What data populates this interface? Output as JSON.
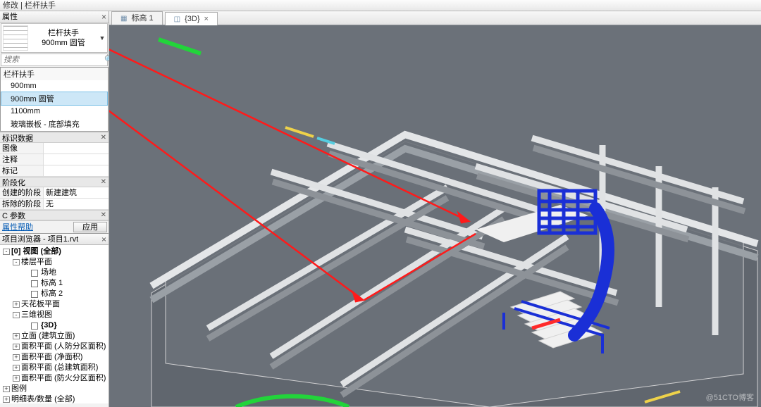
{
  "titlebar": "修改 | 栏杆扶手",
  "properties": {
    "panel_title": "属性",
    "type_name": "栏杆扶手",
    "type_sub": "900mm 圆管",
    "search_placeholder": "搜索",
    "dropdown_category": "栏杆扶手",
    "dropdown_options": [
      "900mm",
      "900mm 圆管",
      "1100mm",
      "玻璃嵌板 - 底部填充"
    ],
    "selected_index": 1,
    "sections": {
      "id_data": "标识数据",
      "image": "图像",
      "note": "注释",
      "mark": "标记",
      "phase": "阶段化",
      "created_phase_k": "创建的阶段",
      "created_phase_v": "新建建筑",
      "demo_phase_k": "拆除的阶段",
      "demo_phase_v": "无",
      "c_params": "C 参数"
    },
    "help_link": "属性帮助",
    "apply_btn": "应用"
  },
  "browser": {
    "title": "项目浏览器 - 项目1.rvt",
    "nodes": [
      {
        "level": 1,
        "toggle": "-",
        "bold": true,
        "text": "[0] 视图 (全部)"
      },
      {
        "level": 2,
        "toggle": "-",
        "text": "楼层平面"
      },
      {
        "level": 3,
        "cb": true,
        "text": "场地"
      },
      {
        "level": 3,
        "cb": true,
        "text": "标高 1"
      },
      {
        "level": 3,
        "cb": true,
        "text": "标高 2"
      },
      {
        "level": 2,
        "toggle": "+",
        "text": "天花板平面"
      },
      {
        "level": 2,
        "toggle": "-",
        "text": "三维视图"
      },
      {
        "level": 3,
        "cb": true,
        "bold": true,
        "text": "{3D}"
      },
      {
        "level": 2,
        "toggle": "+",
        "text": "立面 (建筑立面)"
      },
      {
        "level": 2,
        "toggle": "+",
        "text": "面积平面 (人防分区面积)"
      },
      {
        "level": 2,
        "toggle": "+",
        "text": "面积平面 (净面积)"
      },
      {
        "level": 2,
        "toggle": "+",
        "text": "面积平面 (总建筑面积)"
      },
      {
        "level": 2,
        "toggle": "+",
        "text": "面积平面 (防火分区面积)"
      },
      {
        "level": 1,
        "toggle": "+",
        "text": "图例"
      },
      {
        "level": 1,
        "toggle": "+",
        "text": "明细表/数量 (全部)"
      }
    ]
  },
  "tabs": [
    {
      "label": "标高 1",
      "active": false,
      "close": false,
      "icon": "grid"
    },
    {
      "label": "{3D}",
      "active": true,
      "close": true,
      "icon": "cube"
    }
  ],
  "watermark": "@51CTO博客"
}
